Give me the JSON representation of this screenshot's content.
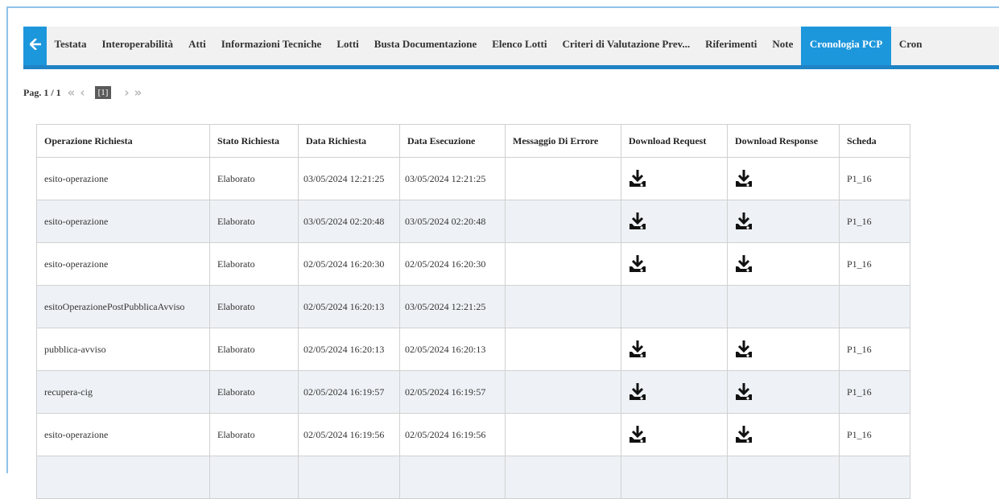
{
  "nav": {
    "back_icon": "arrow-left-icon",
    "tabs": [
      {
        "label": "Testata"
      },
      {
        "label": "Interoperabilità"
      },
      {
        "label": "Atti"
      },
      {
        "label": "Informazioni Tecniche"
      },
      {
        "label": "Lotti"
      },
      {
        "label": "Busta Documentazione"
      },
      {
        "label": "Elenco Lotti"
      },
      {
        "label": "Criteri di Valutazione Prev..."
      },
      {
        "label": "Riferimenti"
      },
      {
        "label": "Note"
      },
      {
        "label": "Cronologia PCP",
        "active": true
      },
      {
        "label": "Cron"
      }
    ]
  },
  "pager": {
    "label": "Pag. 1 / 1",
    "first": "«",
    "prev": "‹",
    "current": "[1]",
    "next": "›",
    "last": "»"
  },
  "table": {
    "headers": [
      "Operazione Richiesta",
      "Stato Richiesta",
      "Data Richiesta",
      "Data Esecuzione",
      "Messaggio Di Errore",
      "Download Request",
      "Download Response",
      "Scheda"
    ],
    "download_icon": "download-icon",
    "rows": [
      {
        "op": "esito-operazione",
        "stato": "Elaborato",
        "data_richiesta": "03/05/2024 12:21:25",
        "data_esecuzione": "03/05/2024 12:21:25",
        "errore": "",
        "req": true,
        "resp": true,
        "scheda": "P1_16"
      },
      {
        "op": "esito-operazione",
        "stato": "Elaborato",
        "data_richiesta": "03/05/2024 02:20:48",
        "data_esecuzione": "03/05/2024 02:20:48",
        "errore": "",
        "req": true,
        "resp": true,
        "scheda": "P1_16"
      },
      {
        "op": "esito-operazione",
        "stato": "Elaborato",
        "data_richiesta": "02/05/2024 16:20:30",
        "data_esecuzione": "02/05/2024 16:20:30",
        "errore": "",
        "req": true,
        "resp": true,
        "scheda": "P1_16"
      },
      {
        "op": "esitoOperazionePostPubblicaAvviso",
        "stato": "Elaborato",
        "data_richiesta": "02/05/2024 16:20:13",
        "data_esecuzione": "03/05/2024 12:21:25",
        "errore": "",
        "req": false,
        "resp": false,
        "scheda": ""
      },
      {
        "op": "pubblica-avviso",
        "stato": "Elaborato",
        "data_richiesta": "02/05/2024 16:20:13",
        "data_esecuzione": "02/05/2024 16:20:13",
        "errore": "",
        "req": true,
        "resp": true,
        "scheda": "P1_16"
      },
      {
        "op": "recupera-cig",
        "stato": "Elaborato",
        "data_richiesta": "02/05/2024 16:19:57",
        "data_esecuzione": "02/05/2024 16:19:57",
        "errore": "",
        "req": true,
        "resp": true,
        "scheda": "P1_16"
      },
      {
        "op": "esito-operazione",
        "stato": "Elaborato",
        "data_richiesta": "02/05/2024 16:19:56",
        "data_esecuzione": "02/05/2024 16:19:56",
        "errore": "",
        "req": true,
        "resp": true,
        "scheda": "P1_16"
      },
      {
        "op": "",
        "stato": "",
        "data_richiesta": "",
        "data_esecuzione": "",
        "errore": "",
        "req": false,
        "resp": false,
        "scheda": ""
      }
    ]
  }
}
